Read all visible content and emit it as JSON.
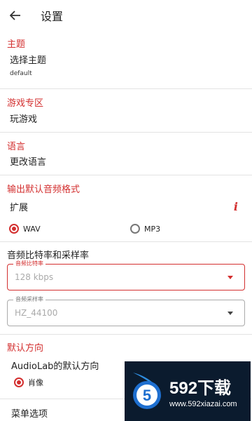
{
  "header": {
    "title": "设置"
  },
  "theme": {
    "section": "主题",
    "label": "选择主题",
    "value": "default"
  },
  "games": {
    "section": "游戏专区",
    "label": "玩游戏"
  },
  "language": {
    "section": "语言",
    "label": "更改语言"
  },
  "output_format": {
    "section": "输出默认音频格式",
    "label": "扩展",
    "options": [
      {
        "label": "WAV",
        "checked": true
      },
      {
        "label": "MP3",
        "checked": false
      }
    ]
  },
  "bitrate": {
    "section": "音频比特率和采样率",
    "bitrate_label": "音频比特率",
    "bitrate_value": "128 kbps",
    "samplerate_label": "音频采样率",
    "samplerate_value": "HZ_44100"
  },
  "orientation": {
    "section": "默认方向",
    "label": "AudioLab的默认方向",
    "option": "肖像"
  },
  "menu": {
    "label": "菜单选项"
  },
  "watermark": {
    "brand": "592下载",
    "url": "www.592xiazai.com"
  },
  "colors": {
    "accent": "#d32f2f",
    "watermark_bg": "#0b1b2e"
  }
}
